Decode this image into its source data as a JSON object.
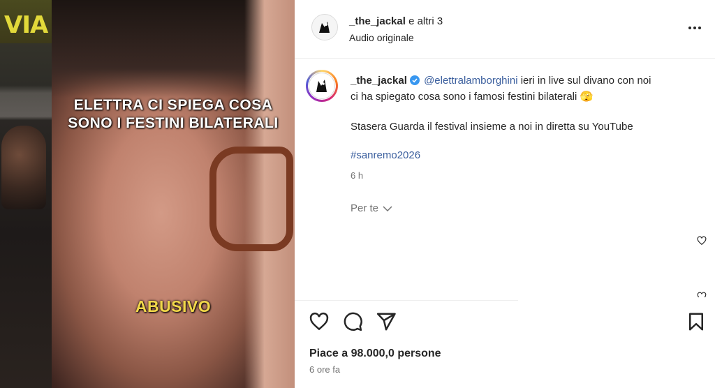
{
  "media": {
    "side_logo_text": "VIA",
    "caption_line1": "ELETTRA CI SPIEGA COSA",
    "caption_line2": "SONO I FESTINI BILATERALI",
    "caption_bottom": "ABUSIVO"
  },
  "header": {
    "username": "_the_jackal",
    "coauthors": "e altri 3",
    "audio": "Audio originale",
    "more_icon": "more-horizontal-icon"
  },
  "comment": {
    "username": "_the_jackal",
    "mention": "@elettralamborghini",
    "text_line1": " ieri in live sul divano con noi",
    "text_line2": "ci ha spiegato cosa sono i famosi festini bilaterali 🫣",
    "text_line3": "Stasera Guarda il festival insieme a noi in diretta su YouTube",
    "hashtag": "#sanremo2026",
    "time": "6 h",
    "per_te": "Per te"
  },
  "actions": {
    "like_icon": "heart-icon",
    "comment_icon": "comment-icon",
    "share_icon": "send-icon",
    "save_icon": "bookmark-icon"
  },
  "footer": {
    "likes": "Piace a 98.000,0 persone",
    "time": "6 ore fa"
  },
  "colors": {
    "link": "#3b5f9e",
    "text": "#262626",
    "muted": "#737373",
    "caption_yellow": "#f1d74a"
  }
}
